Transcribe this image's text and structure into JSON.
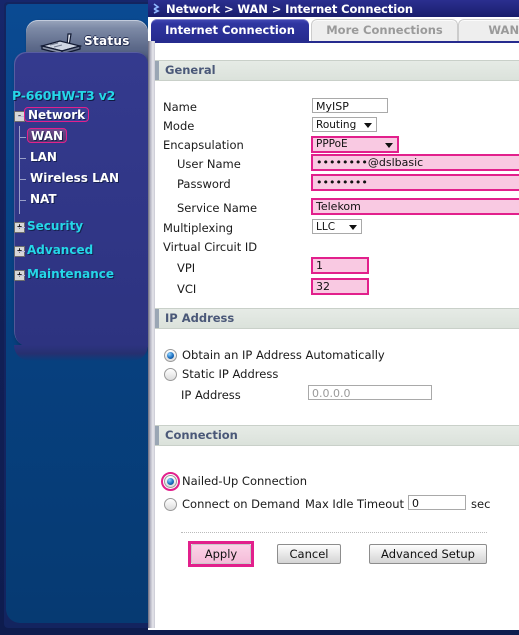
{
  "window": {
    "breadcrumb": "Network > WAN > Internet Connection",
    "breadcrumb_icon": "chevron-right-icon"
  },
  "status_tab": {
    "label": "Status",
    "icon": "router-icon"
  },
  "sidebar": {
    "model": "P-660HW-T3 v2",
    "tree": [
      {
        "label": "Network",
        "expander": "-",
        "selected": true,
        "children": [
          {
            "label": "WAN",
            "selected": true
          },
          {
            "label": "LAN",
            "selected": false
          },
          {
            "label": "Wireless LAN",
            "selected": false
          },
          {
            "label": "NAT",
            "selected": false
          }
        ]
      },
      {
        "label": "Security",
        "expander": "+",
        "selected": false,
        "children": []
      },
      {
        "label": "Advanced",
        "expander": "+",
        "selected": false,
        "children": []
      },
      {
        "label": "Maintenance",
        "expander": "+",
        "selected": false,
        "children": []
      }
    ]
  },
  "tabs": [
    {
      "label": "Internet Connection",
      "active": true
    },
    {
      "label": "More Connections",
      "active": false
    },
    {
      "label": "WAN Ba",
      "active": false
    }
  ],
  "sections": {
    "general": {
      "title": "General",
      "name_label": "Name",
      "name_value": "MyISP",
      "mode_label": "Mode",
      "mode_value": "Routing",
      "encapsulation_label": "Encapsulation",
      "encapsulation_value": "PPPoE",
      "username_label": "User Name",
      "username_value": "••••••••@dslbasic",
      "password_label": "Password",
      "password_value": "••••••••",
      "service_name_label": "Service Name",
      "service_name_value": "Telekom",
      "multiplexing_label": "Multiplexing",
      "multiplexing_value": "LLC",
      "vcid_label": "Virtual Circuit ID",
      "vpi_label": "VPI",
      "vpi_value": "1",
      "vci_label": "VCI",
      "vci_value": "32"
    },
    "ip_address": {
      "title": "IP Address",
      "auto_label": "Obtain an IP Address Automatically",
      "static_label": "Static IP Address",
      "ip_label": "IP Address",
      "ip_placeholder": "0.0.0.0",
      "selected": "auto"
    },
    "connection": {
      "title": "Connection",
      "nailed_label": "Nailed-Up Connection",
      "demand_label": "Connect on Demand",
      "timeout_label": "Max Idle Timeout",
      "timeout_value": "0",
      "timeout_unit": "sec",
      "selected": "nailed"
    }
  },
  "buttons": {
    "apply": "Apply",
    "cancel": "Cancel",
    "advanced": "Advanced Setup"
  },
  "colors": {
    "highlight": "#e2208c",
    "pink_field": "#f9c9e2",
    "accent_cyan": "#25d7e8",
    "tab_active": "#262b8e"
  }
}
